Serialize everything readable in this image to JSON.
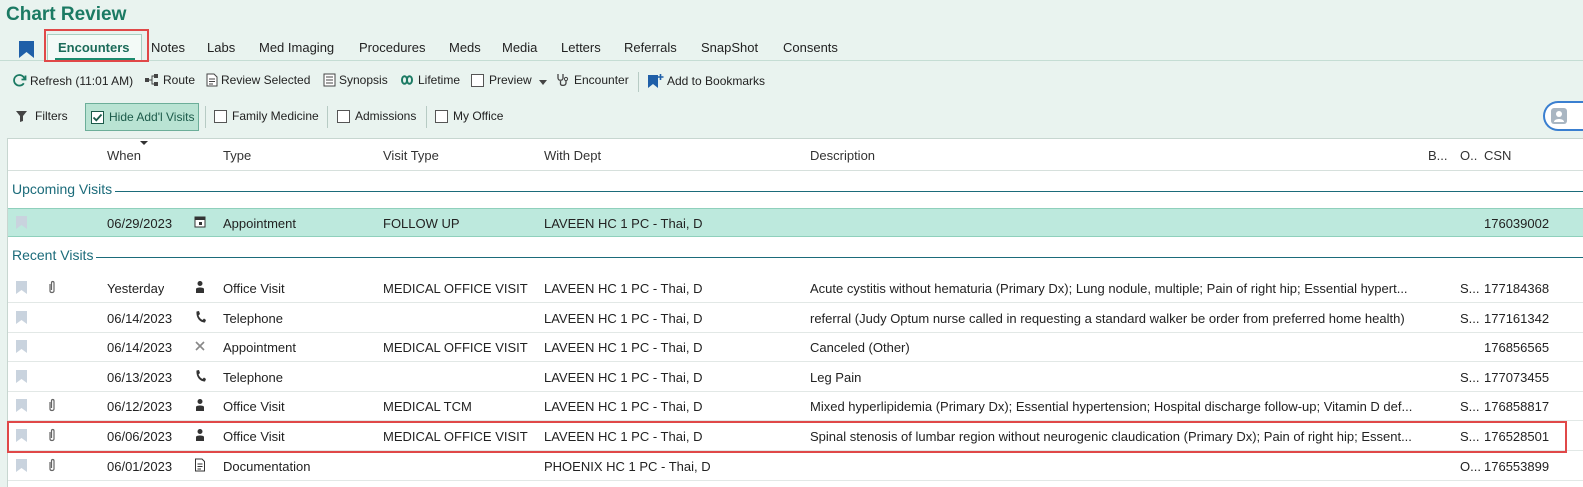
{
  "app": {
    "title": "Chart Review"
  },
  "tabs": [
    {
      "label": "Encounters",
      "active": true
    },
    {
      "label": "Notes"
    },
    {
      "label": "Labs"
    },
    {
      "label": "Med Imaging"
    },
    {
      "label": "Procedures"
    },
    {
      "label": "Meds"
    },
    {
      "label": "Media"
    },
    {
      "label": "Letters"
    },
    {
      "label": "Referrals"
    },
    {
      "label": "SnapShot"
    },
    {
      "label": "Consents"
    }
  ],
  "toolbar": {
    "refresh": "Refresh (11:01 AM)",
    "route": "Route",
    "review_selected": "Review Selected",
    "synopsis": "Synopsis",
    "lifetime": "Lifetime",
    "preview": "Preview",
    "encounter": "Encounter",
    "add_bookmarks": "Add to Bookmarks"
  },
  "filters": {
    "filters_label": "Filters",
    "hide_addl": "Hide Add'l Visits",
    "hide_addl_checked": true,
    "family_medicine": "Family Medicine",
    "admissions": "Admissions",
    "my_office": "My Office"
  },
  "columns": {
    "when": "When",
    "type": "Type",
    "visit_type": "Visit Type",
    "with_dept": "With Dept",
    "description": "Description",
    "b": "B...",
    "o": "O..",
    "csn": "CSN"
  },
  "groups": {
    "upcoming": "Upcoming Visits",
    "recent": "Recent Visits"
  },
  "upcoming": [
    {
      "when": "06/29/2023",
      "icon": "calendar-icon",
      "type": "Appointment",
      "visit_type": "FOLLOW UP",
      "dept": "LAVEEN HC 1 PC - Thai, D",
      "description": "",
      "b": "",
      "csn": "176039002"
    }
  ],
  "recent": [
    {
      "when": "Yesterday",
      "clip": true,
      "icon": "person-icon",
      "type": "Office Visit",
      "visit_type": "MEDICAL OFFICE VISIT",
      "dept": "LAVEEN HC 1 PC - Thai, D",
      "description": "Acute cystitis without hematuria (Primary Dx); Lung nodule, multiple; Pain of right hip; Essential hypert...",
      "b": "S...",
      "csn": "177184368"
    },
    {
      "when": "06/14/2023",
      "clip": false,
      "icon": "phone-icon",
      "type": "Telephone",
      "visit_type": "",
      "dept": "LAVEEN HC 1 PC - Thai, D",
      "description": "referral (Judy Optum nurse called in requesting a standard walker be order from preferred home health)",
      "b": "S...",
      "csn": "177161342"
    },
    {
      "when": "06/14/2023",
      "clip": false,
      "icon": "cancel-icon",
      "type": "Appointment",
      "visit_type": "MEDICAL OFFICE VISIT",
      "dept": "LAVEEN HC 1 PC - Thai, D",
      "description": "Canceled (Other)",
      "b": "",
      "csn": "176856565"
    },
    {
      "when": "06/13/2023",
      "clip": false,
      "icon": "phone-icon",
      "type": "Telephone",
      "visit_type": "",
      "dept": "LAVEEN HC 1 PC - Thai, D",
      "description": "Leg Pain",
      "b": "S...",
      "csn": "177073455"
    },
    {
      "when": "06/12/2023",
      "clip": true,
      "icon": "person-icon",
      "type": "Office Visit",
      "visit_type": "MEDICAL TCM",
      "dept": "LAVEEN HC 1 PC - Thai, D",
      "description": "Mixed hyperlipidemia (Primary Dx); Essential hypertension; Hospital discharge follow-up; Vitamin D def...",
      "b": "S...",
      "csn": "176858817"
    },
    {
      "when": "06/06/2023",
      "clip": true,
      "icon": "person-icon",
      "type": "Office Visit",
      "visit_type": "MEDICAL OFFICE VISIT",
      "dept": "LAVEEN HC 1 PC - Thai, D",
      "description": "Spinal stenosis of lumbar region without neurogenic claudication (Primary Dx); Pain of right hip; Essent...",
      "b": "S...",
      "csn": "176528501"
    },
    {
      "when": "06/01/2023",
      "clip": true,
      "icon": "document-icon",
      "type": "Documentation",
      "visit_type": "",
      "dept": "PHOENIX HC 1 PC - Thai, D",
      "description": "",
      "b": "O...",
      "csn": "176553899"
    }
  ]
}
